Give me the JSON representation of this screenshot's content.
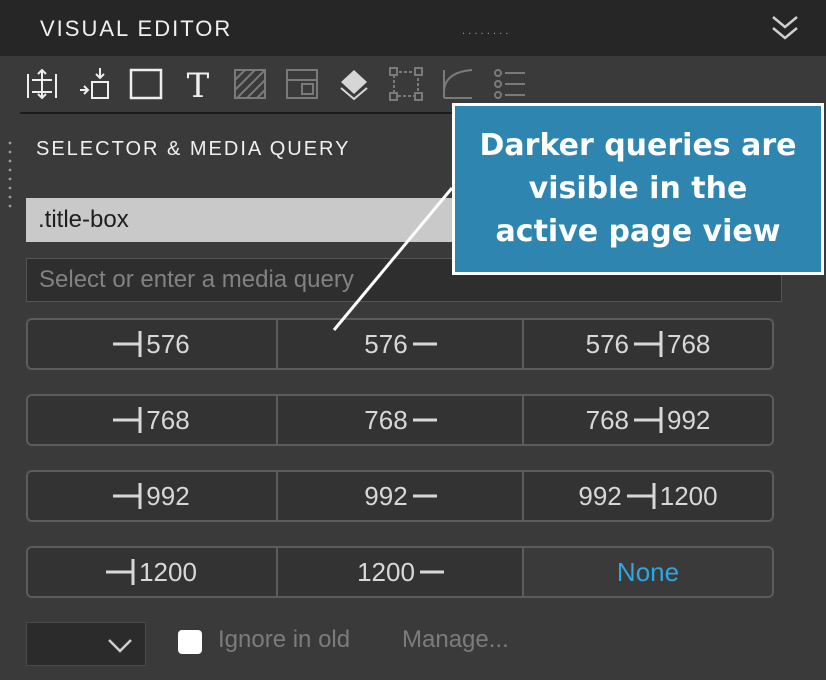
{
  "panel": {
    "title": "VISUAL EDITOR",
    "grip": "........"
  },
  "toolbar": {
    "tools": [
      "spacing-icon",
      "position-icon",
      "box-icon",
      "text-icon",
      "background-icon",
      "layout-icon",
      "color-fill-icon",
      "border-icon",
      "radius-icon",
      "list-icon"
    ]
  },
  "section": {
    "title": "SELECTOR & MEDIA QUERY"
  },
  "selector": {
    "value": ".title-box"
  },
  "media_query": {
    "value": "",
    "placeholder": "Select or enter a media query"
  },
  "query_rows": [
    {
      "max": "576",
      "min": "576",
      "range_from": "576",
      "range_to": "768"
    },
    {
      "max": "768",
      "min": "768",
      "range_from": "768",
      "range_to": "992"
    },
    {
      "max": "992",
      "min": "992",
      "range_from": "992",
      "range_to": "1200"
    },
    {
      "max": "1200",
      "min": "1200",
      "none": "None"
    }
  ],
  "footer": {
    "ignore_label": "Ignore in old",
    "manage_label": "Manage..."
  },
  "callout": {
    "text": "Darker queries are visible in the active page view"
  },
  "colors": {
    "panel_bg": "#3a3a3a",
    "titlebar_bg": "#262626",
    "accent": "#2fa6dd",
    "callout_bg": "#2e86b0"
  }
}
